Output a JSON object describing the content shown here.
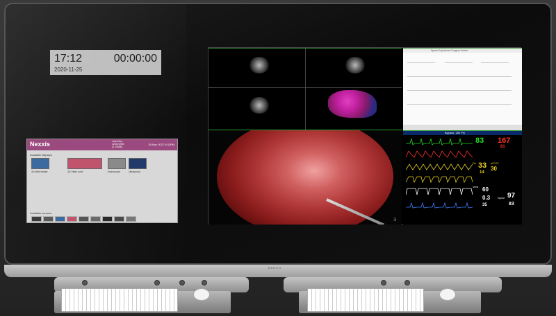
{
  "clock": {
    "time": "17:12",
    "timer": "00:00:00",
    "date": "2020-11-25"
  },
  "nexxis": {
    "title": "Nexxis",
    "patient_lines": [
      "John Doe",
      "12/31/1950",
      "(1.23456)"
    ],
    "date": "26 Nov 2027   6:32PM",
    "available_displays_label": "Available displays",
    "available_sources_label": "Available sources",
    "thumbs": [
      {
        "caption": "3D Web viewer",
        "color": "#3a6aa0"
      },
      {
        "caption": "3D Video conf.",
        "color": "#c0546c"
      },
      {
        "caption": "Endoscope",
        "color": "#8a8a8a"
      },
      {
        "caption": "Ultrasound",
        "color": "#223a6a"
      }
    ],
    "sources": [
      "#3a3a3a",
      "#5a5a5a",
      "#3a6aa0",
      "#c0546c",
      "#555",
      "#6a6a6a",
      "#2a2a2a",
      "#4a4a4a",
      "#777"
    ]
  },
  "web": {
    "title": "Space Experience Surgery Center"
  },
  "vitals": {
    "header": "Bypass: 180 Pt1",
    "hr": "83",
    "hr2": "167",
    "hr3": "81",
    "pa1": "33",
    "pa2": "14",
    "etco2": "30",
    "etco2_label": "etCO2",
    "resp": "60",
    "resp2": "0.3",
    "resp3": "35",
    "spo2": "97",
    "spo2b": "83",
    "spo2_label": "SpO2",
    "vent_label": "Vent",
    "pa_label": "PA",
    "colors": {
      "green": "#26d926",
      "red": "#ff3030",
      "yellow": "#e8d020",
      "white": "#ffffff",
      "blue": "#4080ff"
    }
  },
  "surgical": {
    "number": "3"
  },
  "brand": "BARCO"
}
